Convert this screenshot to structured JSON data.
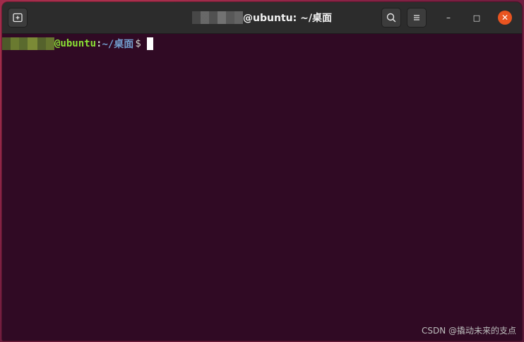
{
  "window": {
    "title_suffix": "@ubuntu: ~/桌面"
  },
  "titlebar": {
    "new_tab_icon": "new-tab-icon",
    "search_icon": "search-icon",
    "menu_icon": "hamburger-menu-icon",
    "minimize_glyph": "–",
    "maximize_glyph": "□",
    "close_glyph": "✕"
  },
  "terminal": {
    "host": "@ubuntu",
    "colon": ":",
    "path": "~/桌面",
    "prompt_symbol": "$"
  },
  "watermark": {
    "text": "CSDN @撬动未来的支点"
  },
  "colors": {
    "terminal_bg": "#300a24",
    "titlebar_bg": "#2c2c2c",
    "host_green": "#8ae234",
    "path_blue": "#729fcf",
    "close_orange": "#e95420"
  }
}
